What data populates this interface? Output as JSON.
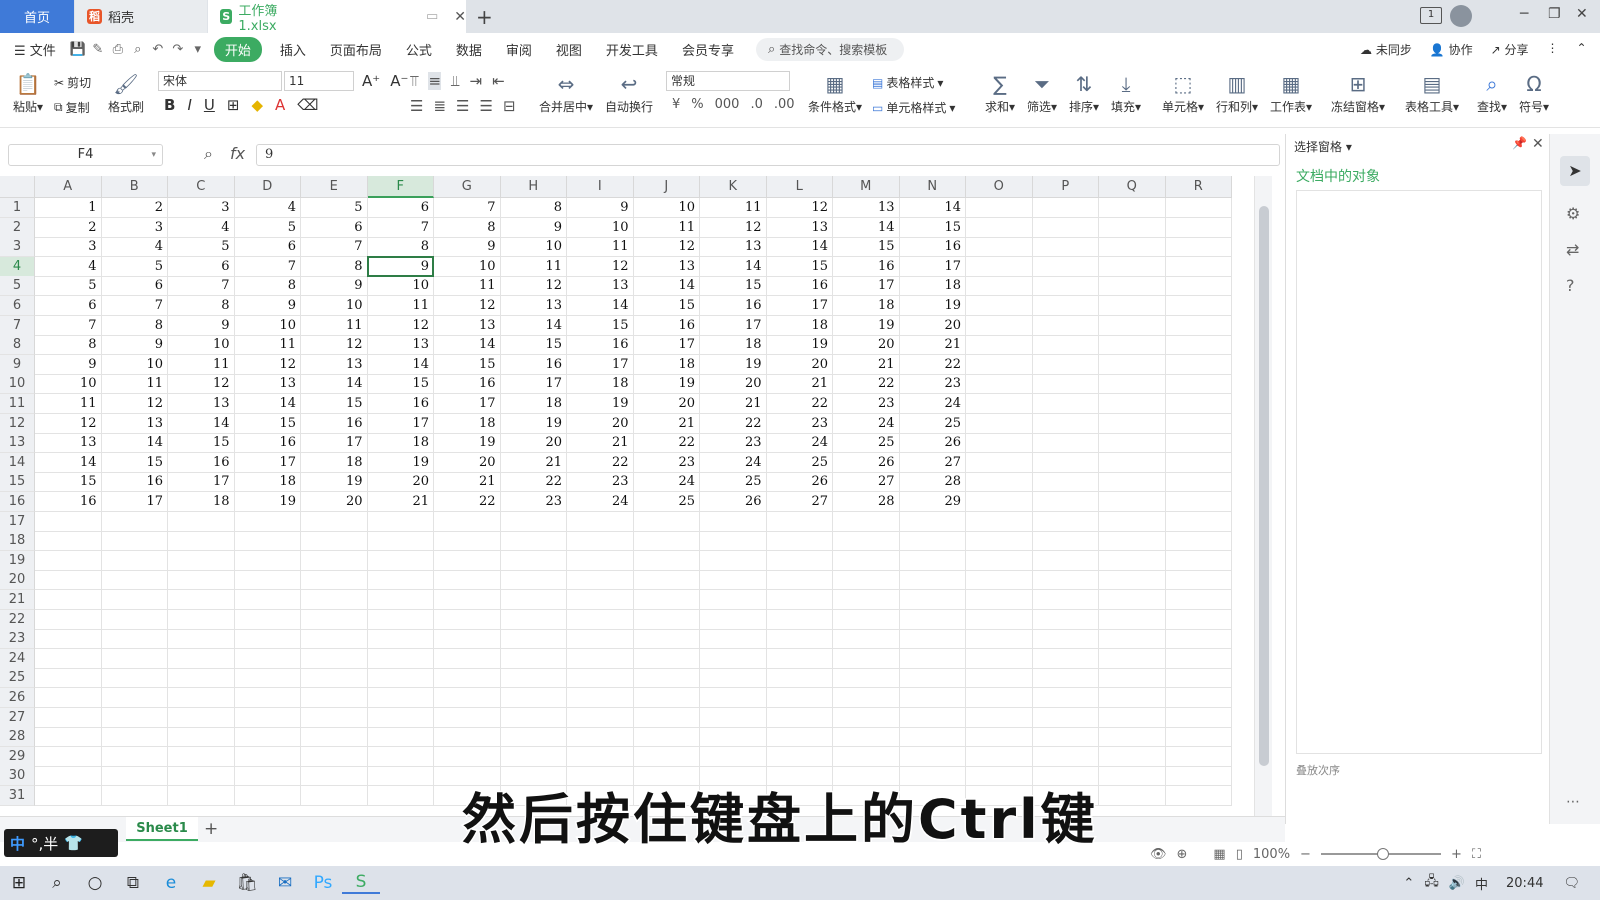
{
  "tabs": {
    "home": "首页",
    "wps": "稻壳",
    "doc": "工作簿1.xlsx",
    "add": "+"
  },
  "window_controls": {
    "minimize": "─",
    "restore": "❐",
    "close": "✕"
  },
  "menu": {
    "file": "文件",
    "items": [
      "开始",
      "插入",
      "页面布局",
      "公式",
      "数据",
      "审阅",
      "视图",
      "开发工具",
      "会员专享"
    ],
    "search_placeholder": "查找命令、搜索模板",
    "unsynced": "未同步",
    "collab": "协作",
    "share": "分享"
  },
  "ribbon": {
    "paste": "粘贴",
    "cut": "剪切",
    "copy": "复制",
    "format_painter": "格式刷",
    "font_name": "宋体",
    "font_size": "11",
    "merge_center": "合并居中",
    "wrap_text": "自动换行",
    "number_format": "常规",
    "cond_format": "条件格式",
    "table_style": "表格样式",
    "cell_style": "单元格样式",
    "sum": "求和",
    "filter": "筛选",
    "sort": "排序",
    "fill": "填充",
    "cell": "单元格",
    "row_col": "行和列",
    "worksheet": "工作表",
    "freeze": "冻结窗格",
    "table_tools": "表格工具",
    "find": "查找",
    "symbol": "符号"
  },
  "formula_bar": {
    "name_box": "F4",
    "fx": "fx",
    "value": "9"
  },
  "grid": {
    "columns": [
      "A",
      "B",
      "C",
      "D",
      "E",
      "F",
      "G",
      "H",
      "I",
      "J",
      "K",
      "L",
      "M",
      "N",
      "O",
      "P",
      "Q",
      "R"
    ],
    "active_column": "F",
    "active_row": "4",
    "row_numbers": [
      "1",
      "2",
      "3",
      "4",
      "5",
      "6",
      "7",
      "8",
      "9",
      "10",
      "11",
      "12",
      "13",
      "14",
      "15",
      "16",
      "17",
      "18",
      "19",
      "20",
      "21",
      "22",
      "23",
      "24",
      "25",
      "26",
      "27",
      "28",
      "29",
      "30",
      "31"
    ],
    "data": [
      [
        "1",
        "2",
        "3",
        "4",
        "5",
        "6",
        "7",
        "8",
        "9",
        "10",
        "11",
        "12",
        "13",
        "14"
      ],
      [
        "2",
        "3",
        "4",
        "5",
        "6",
        "7",
        "8",
        "9",
        "10",
        "11",
        "12",
        "13",
        "14",
        "15"
      ],
      [
        "3",
        "4",
        "5",
        "6",
        "7",
        "8",
        "9",
        "10",
        "11",
        "12",
        "13",
        "14",
        "15",
        "16"
      ],
      [
        "4",
        "5",
        "6",
        "7",
        "8",
        "9",
        "10",
        "11",
        "12",
        "13",
        "14",
        "15",
        "16",
        "17"
      ],
      [
        "5",
        "6",
        "7",
        "8",
        "9",
        "10",
        "11",
        "12",
        "13",
        "14",
        "15",
        "16",
        "17",
        "18"
      ],
      [
        "6",
        "7",
        "8",
        "9",
        "10",
        "11",
        "12",
        "13",
        "14",
        "15",
        "16",
        "17",
        "18",
        "19"
      ],
      [
        "7",
        "8",
        "9",
        "10",
        "11",
        "12",
        "13",
        "14",
        "15",
        "16",
        "17",
        "18",
        "19",
        "20"
      ],
      [
        "8",
        "9",
        "10",
        "11",
        "12",
        "13",
        "14",
        "15",
        "16",
        "17",
        "18",
        "19",
        "20",
        "21"
      ],
      [
        "9",
        "10",
        "11",
        "12",
        "13",
        "14",
        "15",
        "16",
        "17",
        "18",
        "19",
        "20",
        "21",
        "22"
      ],
      [
        "10",
        "11",
        "12",
        "13",
        "14",
        "15",
        "16",
        "17",
        "18",
        "19",
        "20",
        "21",
        "22",
        "23"
      ],
      [
        "11",
        "12",
        "13",
        "14",
        "15",
        "16",
        "17",
        "18",
        "19",
        "20",
        "21",
        "22",
        "23",
        "24"
      ],
      [
        "12",
        "13",
        "14",
        "15",
        "16",
        "17",
        "18",
        "19",
        "20",
        "21",
        "22",
        "23",
        "24",
        "25"
      ],
      [
        "13",
        "14",
        "15",
        "16",
        "17",
        "18",
        "19",
        "20",
        "21",
        "22",
        "23",
        "24",
        "25",
        "26"
      ],
      [
        "14",
        "15",
        "16",
        "17",
        "18",
        "19",
        "20",
        "21",
        "22",
        "23",
        "24",
        "25",
        "26",
        "27"
      ],
      [
        "15",
        "16",
        "17",
        "18",
        "19",
        "20",
        "21",
        "22",
        "23",
        "24",
        "25",
        "26",
        "27",
        "28"
      ],
      [
        "16",
        "17",
        "18",
        "19",
        "20",
        "21",
        "22",
        "23",
        "24",
        "25",
        "26",
        "27",
        "28",
        "29"
      ]
    ]
  },
  "panel": {
    "title": "选择窗格",
    "section": "文档中的对象",
    "footer": "叠放次序"
  },
  "sheets": {
    "active": "Sheet1",
    "add": "+"
  },
  "status": {
    "zoom": "100%"
  },
  "taskbar": {
    "time": "20:44"
  },
  "ime": {
    "lang": "中",
    "mode": "°,半"
  },
  "subtitle": "然后按住键盘上的Ctrl键",
  "colors": {
    "accent": "#3cab62",
    "home_tab": "#3f7ad8",
    "selection": "#2e7d46"
  }
}
